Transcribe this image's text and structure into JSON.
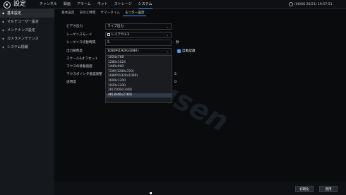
{
  "app": {
    "title": "設定",
    "datetime": "(06/06 20/21) 19:57:51"
  },
  "top_nav": [
    "チャンネル",
    "録画",
    "アラーム",
    "ネット",
    "ストレージ",
    "システム"
  ],
  "top_nav_active": 5,
  "sidebar": [
    {
      "label": "基本設定",
      "active": true
    },
    {
      "label": "マルチユーザー設定",
      "active": false
    },
    {
      "label": "メンテナンス設定",
      "active": false
    },
    {
      "label": "カメラメンテナンス",
      "active": false
    },
    {
      "label": "システム情報",
      "active": false
    }
  ],
  "sub_tabs": [
    "基本設定",
    "日付と時間",
    "サマータイム",
    "モニター設定"
  ],
  "sub_tab_active": 3,
  "form": {
    "video_output": {
      "label": "ビデオ出力",
      "value": "ライブ出力"
    },
    "sequence_mode": {
      "label": "シーケンスモード",
      "value": "レイアウト1"
    },
    "sequence_interval": {
      "label": "シーケンス切替時間",
      "value": "5",
      "unit": "秒"
    },
    "output_resolution": {
      "label": "出力解像度",
      "value": "1080P(1920x1080)"
    },
    "auto_detect": {
      "label": "自動認識",
      "checked": true
    },
    "scale_offset": {
      "label": "スケール&オフセット"
    },
    "mouse_speed": {
      "label": "マウスの移動速度"
    },
    "mouse_pointer_size": {
      "label": "マウスポインタ速度調整",
      "value": "5"
    },
    "transparency": {
      "label": "透明度",
      "value": "0"
    }
  },
  "resolution_options": [
    "1024x768",
    "1280x1024",
    "1440x900",
    "720P(1280x720)",
    "1080P(1920x1080)",
    "1600x1200",
    "1920x1200",
    "2K(2560x1440)",
    "4K(3840x2160)"
  ],
  "resolution_highlight": 8,
  "watermark": "Kmusen",
  "buttons": {
    "reset": "初期化",
    "apply": "適用"
  }
}
